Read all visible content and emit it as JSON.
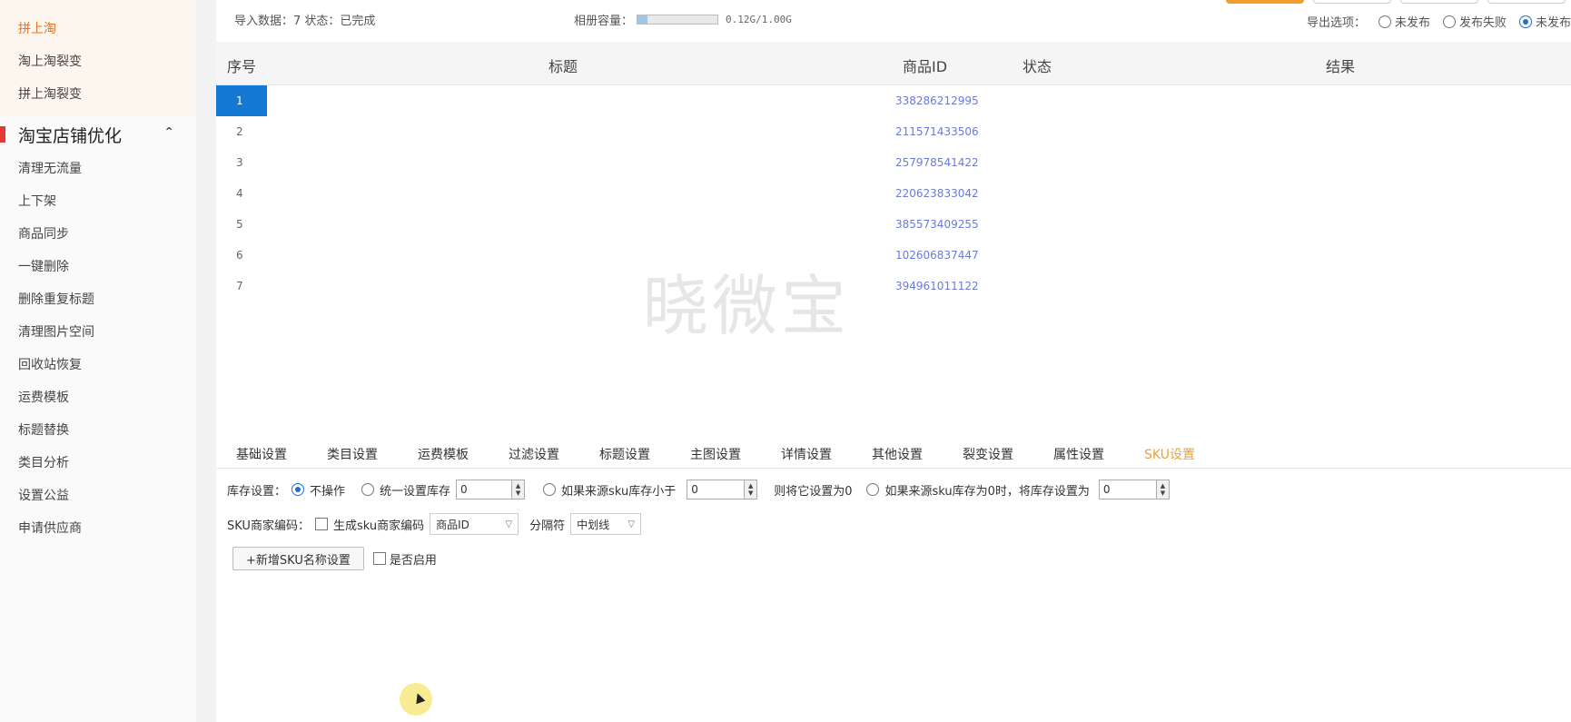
{
  "sidebar": {
    "items_top": [
      "拼上淘",
      "淘上淘裂变",
      "拼上淘裂变"
    ],
    "active_top": "拼上淘",
    "section_title": "淘宝店铺优化",
    "section_chevron": "^",
    "items": [
      "清理无流量",
      "上下架",
      "商品同步",
      "一键删除",
      "删除重复标题",
      "清理图片空间",
      "回收站恢复",
      "运费模板",
      "标题替换",
      "类目分析",
      "设置公益",
      "申请供应商"
    ]
  },
  "topbar": {
    "import_stat": "导入数据：7 状态：已完成",
    "capacity_label": "相册容量：",
    "capacity_text": "0.12G/1.00G",
    "capacity_fraction": 0.12,
    "export_label": "导出选项：",
    "export_options": [
      "未发布",
      "发布失败",
      "未发布"
    ],
    "export_selected": 2
  },
  "table": {
    "headers": [
      "序号",
      "标题",
      "商品ID",
      "状态",
      "结果"
    ],
    "rows": [
      {
        "idx": "1",
        "pid": "338286212995"
      },
      {
        "idx": "2",
        "pid": "211571433506"
      },
      {
        "idx": "3",
        "pid": "257978541422"
      },
      {
        "idx": "4",
        "pid": "220623833042"
      },
      {
        "idx": "5",
        "pid": "385573409255"
      },
      {
        "idx": "6",
        "pid": "102606837447"
      },
      {
        "idx": "7",
        "pid": "394961011122"
      }
    ],
    "selected_row": 0,
    "watermark": "晓微宝"
  },
  "tabs": [
    "基础设置",
    "类目设置",
    "运费模板",
    "过滤设置",
    "标题设置",
    "主图设置",
    "详情设置",
    "其他设置",
    "裂变设置",
    "属性设置",
    "SKU设置"
  ],
  "active_tab": "SKU设置",
  "sku": {
    "stock_label": "库存设置：",
    "opt_noop": "不操作",
    "opt_unified": "统一设置库存",
    "unified_value": "0",
    "opt_if_less": "如果来源sku库存小于",
    "less_value": "0",
    "less_suffix": "则将它设置为0",
    "opt_if_zero": "如果来源sku库存为0时，将库存设置为",
    "zero_value": "0",
    "code_label": "SKU商家编码：",
    "gen_code": "生成sku商家编码",
    "code_source": "商品ID",
    "sep_label": "分隔符",
    "sep_value": "中划线",
    "add_name_btn": "+新增SKU名称设置",
    "enable_label": "是否启用"
  }
}
